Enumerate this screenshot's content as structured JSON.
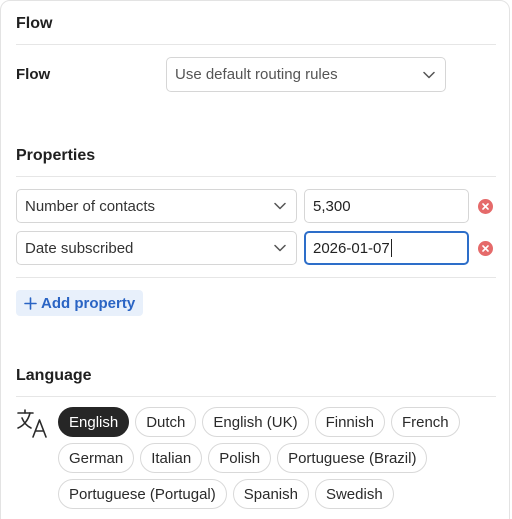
{
  "flow_section": {
    "title": "Flow",
    "field_label": "Flow",
    "select_value": "Use default routing rules"
  },
  "properties_section": {
    "title": "Properties",
    "rows": [
      {
        "property": "Number of contacts",
        "value": "5,300"
      },
      {
        "property": "Date subscribed",
        "value": "2026-01-07"
      }
    ],
    "add_label": "Add property",
    "add_icon": "plus-icon",
    "remove_icon": "close-icon",
    "remove_color": "#e56a6a"
  },
  "language_section": {
    "title": "Language",
    "icon": "translate-icon",
    "selected": "English",
    "languages": [
      "English",
      "Dutch",
      "English (UK)",
      "Finnish",
      "French",
      "German",
      "Italian",
      "Polish",
      "Portuguese (Brazil)",
      "Portuguese (Portugal)",
      "Spanish",
      "Swedish"
    ]
  },
  "colors": {
    "accent": "#2a64c4",
    "focus_border": "#2d6ec9",
    "selected_chip": "#262626"
  }
}
